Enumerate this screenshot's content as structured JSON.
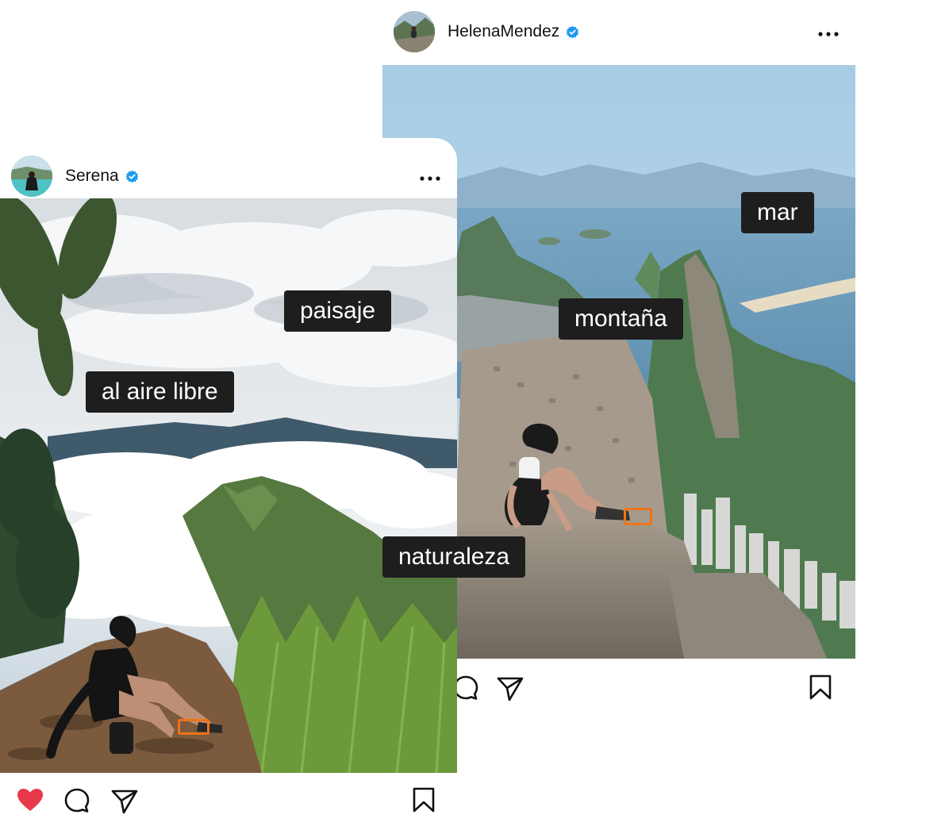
{
  "posts": [
    {
      "username": "HelenaMendez",
      "verified": true,
      "avatar": "mountain-ledge-avatar",
      "photo": "woman-sitting-on-rock-above-city-and-sea",
      "actions": [
        "comment-icon",
        "send-icon",
        "bookmark-icon"
      ]
    },
    {
      "username": "Serena",
      "verified": true,
      "avatar": "person-by-turquoise-water-avatar",
      "photo": "woman-sitting-on-hilltop-above-clouds",
      "liked": true,
      "actions": [
        "heart-icon",
        "comment-icon",
        "send-icon",
        "bookmark-icon"
      ]
    }
  ],
  "tags": {
    "mar": "mar",
    "montana": "montaña",
    "paisaje": "paisaje",
    "aire_libre": "al aire libre",
    "naturaleza": "naturaleza"
  },
  "colors": {
    "verified_badge": "#1d9bf0",
    "like_heart": "#e8394b",
    "tag_background": "#1e1e1e",
    "product_highlight": "#f07318"
  }
}
